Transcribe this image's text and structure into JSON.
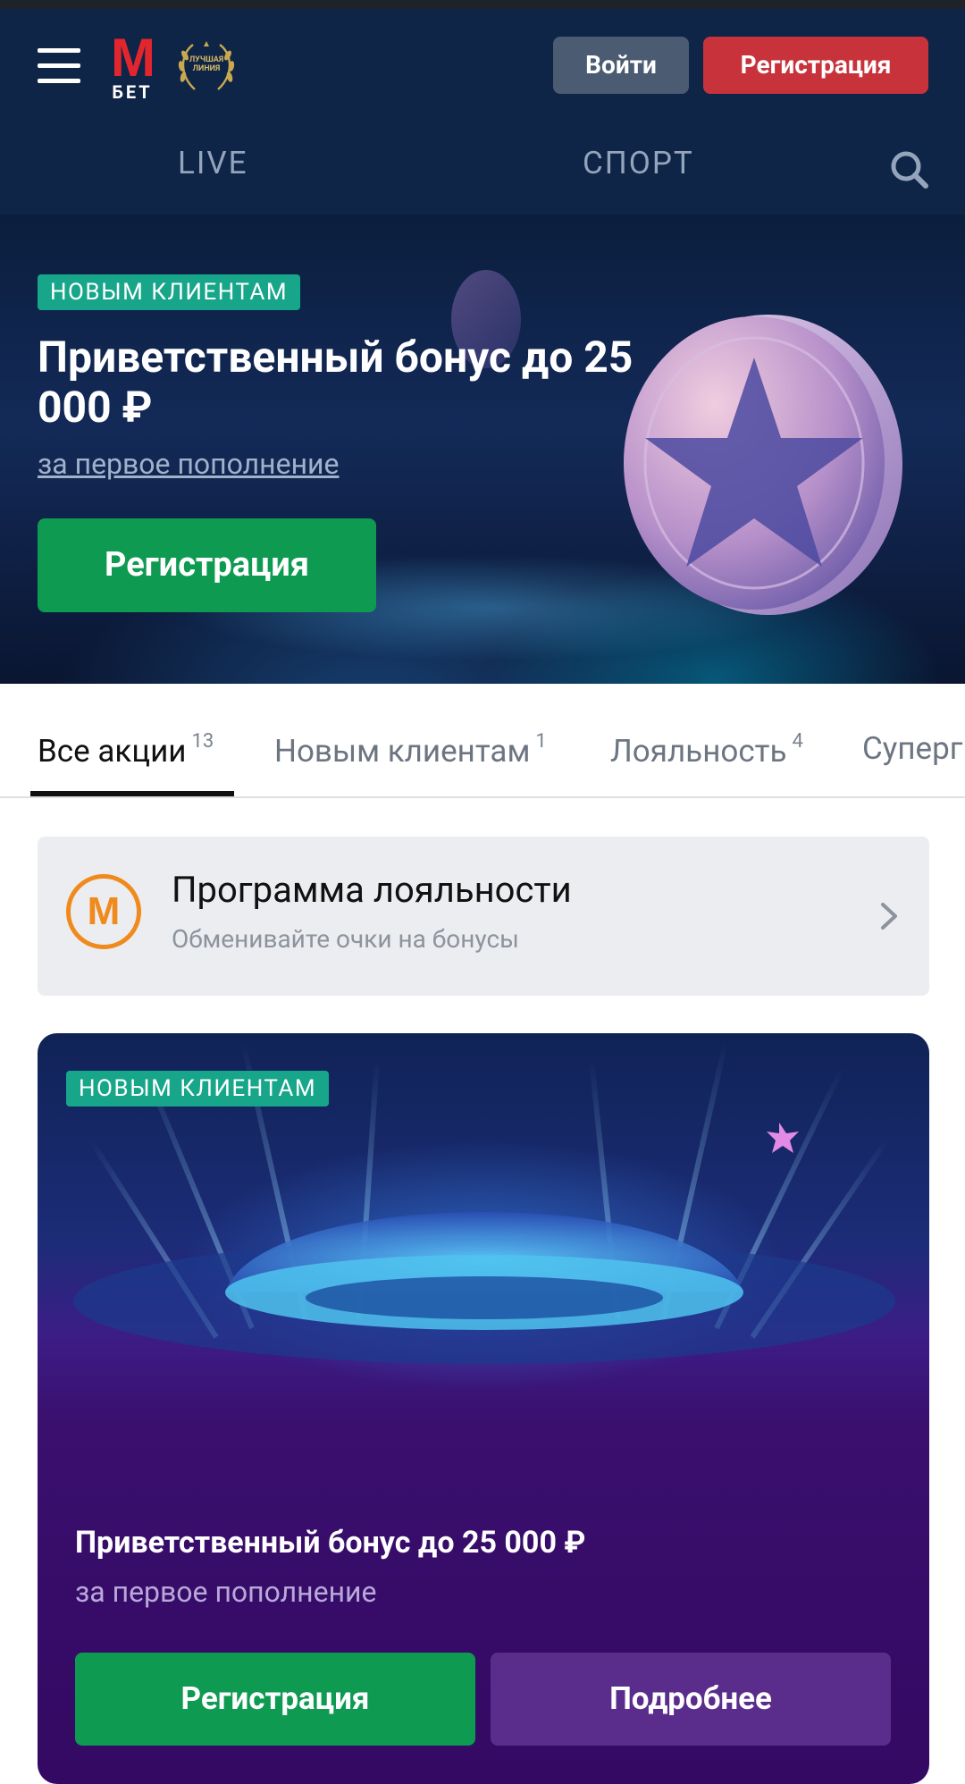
{
  "header": {
    "logo_text": "M",
    "logo_sub": "БЕТ",
    "award_text": "ЛУЧШАЯ ЛИНИЯ",
    "login_label": "Войти",
    "register_label": "Регистрация",
    "nav": [
      {
        "label": "LIVE"
      },
      {
        "label": "СПОРТ"
      }
    ],
    "icons": {
      "menu": "hamburger-menu-icon",
      "search": "search-icon"
    }
  },
  "hero": {
    "badge": "НОВЫМ КЛИЕНТАМ",
    "title": "Приветственный бонус до 25 000 ₽",
    "subtitle": "за первое пополнение",
    "cta": "Регистрация"
  },
  "tabs": [
    {
      "label": "Все акции",
      "count": "13",
      "active": true
    },
    {
      "label": "Новым клиентам",
      "count": "1",
      "active": false
    },
    {
      "label": "Лояльность",
      "count": "4",
      "active": false
    },
    {
      "label": "Суперг",
      "count": "",
      "active": false
    }
  ],
  "loyalty": {
    "icon_letter": "M",
    "title": "Программа лояльности",
    "subtitle": "Обменивайте очки на бонусы",
    "chevron": "chevron-right-icon"
  },
  "promo_card": {
    "badge": "НОВЫМ КЛИЕНТАМ",
    "title": "Приветственный бонус до 25 000 ₽",
    "subtitle": "за первое пополнение",
    "register_label": "Регистрация",
    "more_label": "Подробнее"
  },
  "colors": {
    "header_bg": "#0e2547",
    "brand_red": "#e3262d",
    "register_red": "#c8333b",
    "green": "#0f9a52",
    "badge_teal": "#17a68a",
    "loyalty_orange": "#f08a1c",
    "purple_button": "#5a2d8c"
  }
}
